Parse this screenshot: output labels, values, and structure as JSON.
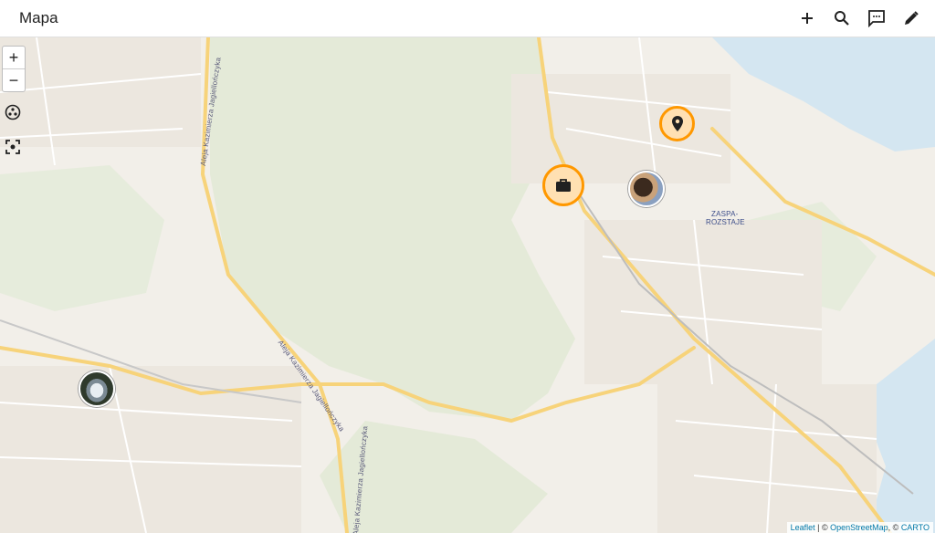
{
  "header": {
    "title": "Mapa",
    "actions": [
      {
        "icon": "plus-icon",
        "label": "add"
      },
      {
        "icon": "search-icon",
        "label": "search"
      },
      {
        "icon": "comment-icon",
        "label": "messages"
      },
      {
        "icon": "pencil-icon",
        "label": "edit"
      }
    ]
  },
  "map_controls": {
    "zoom_in": "+",
    "zoom_out": "−"
  },
  "markers": [
    {
      "type": "briefcase",
      "icon": "briefcase-icon",
      "accent": "#ff9800"
    },
    {
      "type": "location",
      "icon": "location-pin-icon",
      "accent": "#ff9800"
    },
    {
      "type": "dog-photo",
      "icon": "dog-avatar"
    },
    {
      "type": "car-photo",
      "icon": "car-avatar"
    }
  ],
  "map_labels": {
    "district_line1": "ZASPA-",
    "district_line2": "ROZSTAJE",
    "road_1": "Aleja Kazimierza Jagiellończyka",
    "road_2": "Aleja Kazimierza Jagiellończyka",
    "road_3": "Aleja Kazimierza Jagiellończyka"
  },
  "attribution": {
    "leaflet": "Leaflet",
    "sep1": " | © ",
    "osm": "OpenStreetMap",
    "sep2": ", © ",
    "carto": "CARTO"
  },
  "colors": {
    "marker_ring": "#ff9800",
    "marker_fill": "#ffe0b2",
    "water": "#d4e6f1",
    "green": "#dfe8d3",
    "road_major": "#f7d37a"
  }
}
